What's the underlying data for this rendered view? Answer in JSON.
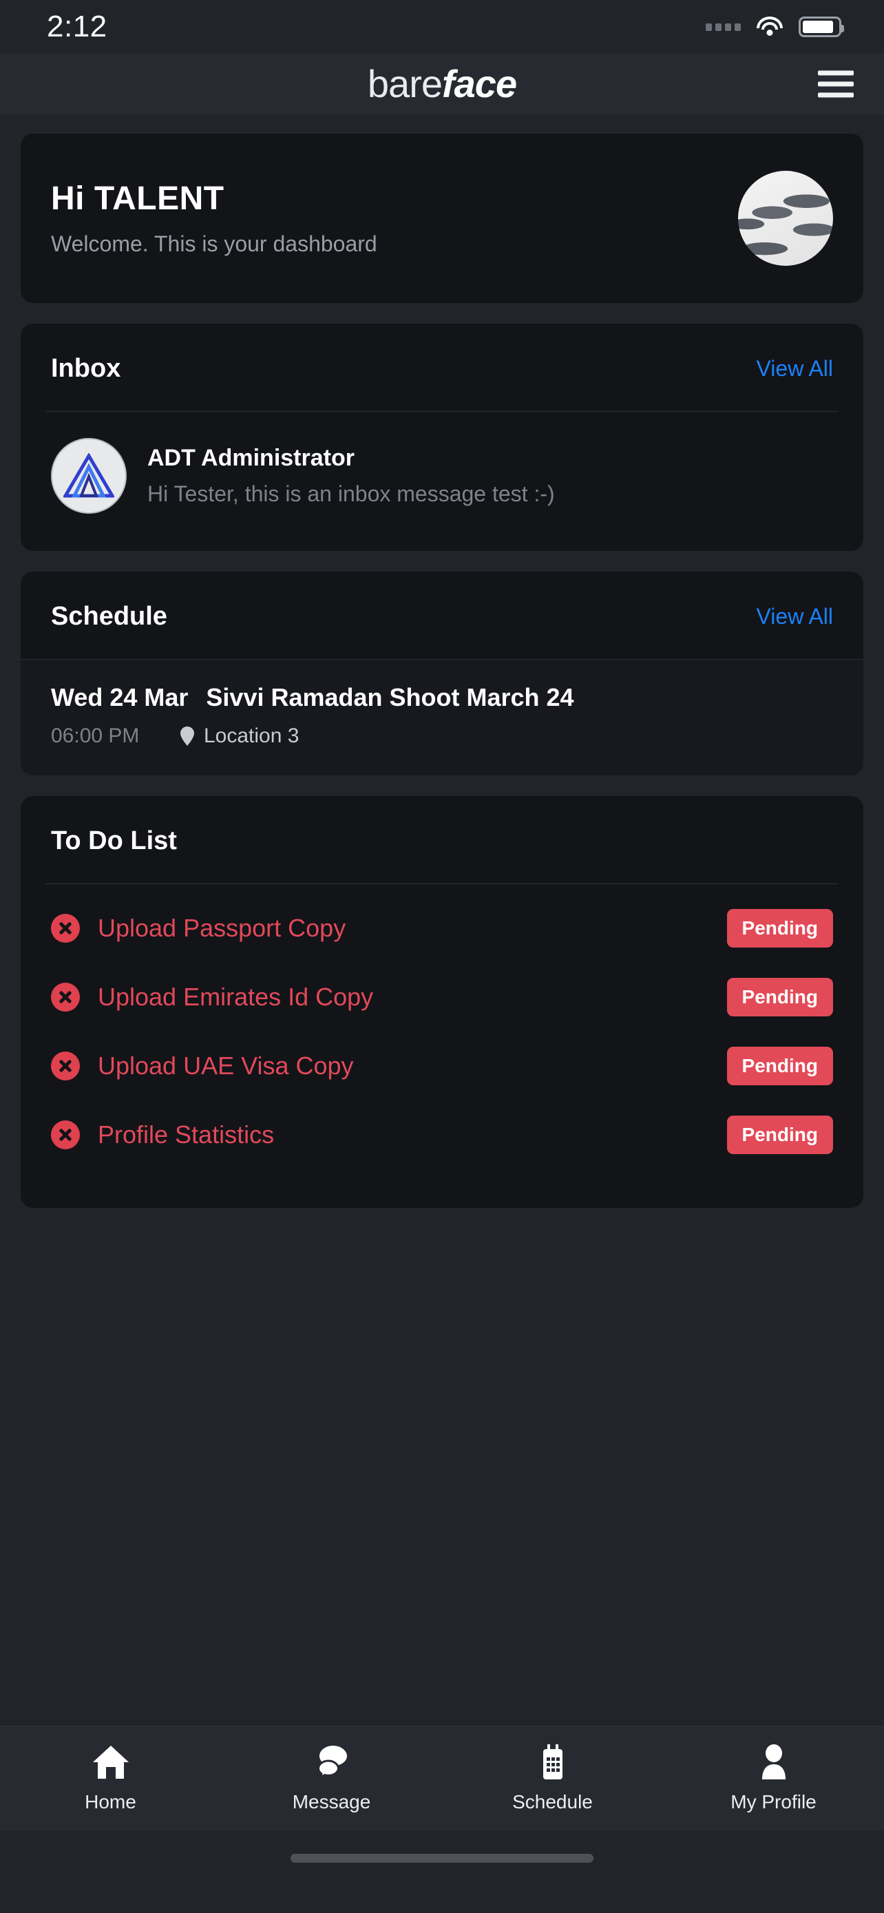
{
  "status_bar": {
    "time": "2:12",
    "signal_icon": "signal-dots-icon",
    "wifi_icon": "wifi-icon",
    "battery_icon": "battery-icon"
  },
  "header": {
    "logo_light": "bare",
    "logo_bold": "face",
    "menu_icon": "hamburger-menu-icon"
  },
  "greeting": {
    "title": "Hi TALENT",
    "subtitle": "Welcome. This is your dashboard",
    "avatar_icon": "user-avatar-photo"
  },
  "inbox": {
    "title": "Inbox",
    "view_all": "View All",
    "message": {
      "sender": "ADT Administrator",
      "preview": "Hi Tester, this is an inbox message test :-)",
      "avatar_icon": "adt-triangle-logo-icon"
    }
  },
  "schedule": {
    "title": "Schedule",
    "view_all": "View All",
    "event": {
      "date": "Wed 24 Mar",
      "name": "Sivvi Ramadan Shoot March 24",
      "time": "06:00 PM",
      "location": "Location 3",
      "location_icon": "map-pin-icon"
    }
  },
  "todo": {
    "title": "To Do List",
    "items": [
      {
        "label": "Upload Passport Copy",
        "status": "Pending",
        "icon": "x-circle-icon"
      },
      {
        "label": "Upload Emirates Id Copy",
        "status": "Pending",
        "icon": "x-circle-icon"
      },
      {
        "label": "Upload UAE Visa Copy",
        "status": "Pending",
        "icon": "x-circle-icon"
      },
      {
        "label": "Profile Statistics",
        "status": "Pending",
        "icon": "x-circle-icon"
      }
    ]
  },
  "tabbar": {
    "items": [
      {
        "label": "Home",
        "icon": "home-icon"
      },
      {
        "label": "Message",
        "icon": "chat-bubbles-icon"
      },
      {
        "label": "Schedule",
        "icon": "calendar-icon"
      },
      {
        "label": "My Profile",
        "icon": "person-icon"
      }
    ]
  },
  "colors": {
    "accent_blue": "#1b81fb",
    "danger_red": "#e34a58",
    "card_bg": "#121418",
    "page_bg": "#212429"
  }
}
